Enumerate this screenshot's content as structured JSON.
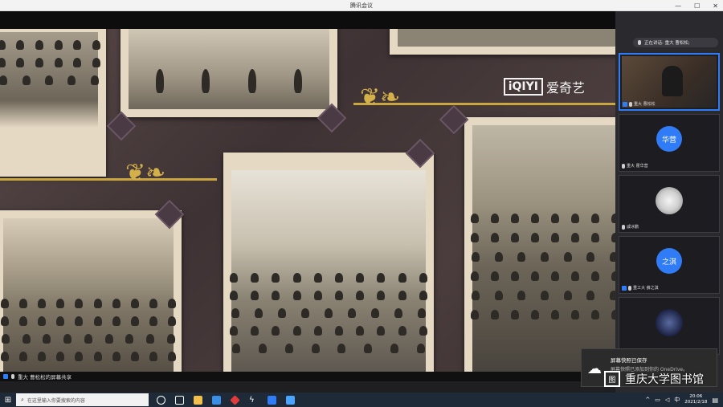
{
  "window": {
    "title": "腾讯会议",
    "controls": [
      "—",
      "☐",
      "✕"
    ]
  },
  "share": {
    "watermark_logo": "iQIYI",
    "watermark_text": "爱奇艺",
    "share_label": "重大 曹松松的屏幕共享"
  },
  "panel": {
    "speaking_label": "正在讲话: 重大 曹松松;",
    "tiles": [
      {
        "name": "重大 曹松松",
        "kind": "video"
      },
      {
        "name": "重大 霍华营",
        "kind": "initials",
        "initials": "华营",
        "color": "#2f7cf6"
      },
      {
        "name": "戚冰鹏",
        "kind": "image"
      },
      {
        "name": "重工大 薛之淇",
        "kind": "initials",
        "initials": "之淇",
        "color": "#2f7cf6"
      },
      {
        "name": "",
        "kind": "image"
      }
    ]
  },
  "toast": {
    "title": "屏幕快照已保存",
    "message": "屏幕快照已添加到你的 OneDrive。"
  },
  "watermark": {
    "text": "重庆大学图书馆"
  },
  "taskbar": {
    "search_placeholder": "在这里输入你要搜索的内容",
    "time": "20:06",
    "date": "2021/2/18"
  }
}
